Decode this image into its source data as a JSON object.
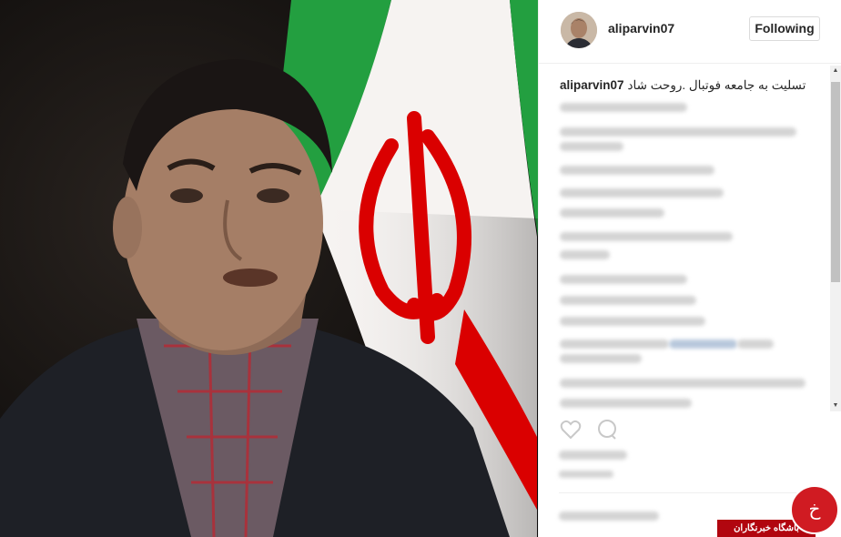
{
  "post": {
    "username": "aliparvin07",
    "follow_label": "Following",
    "caption_text": "تسلیت به جامعه فوتبال .روحت شاد"
  },
  "watermark": {
    "text": "باشگاه خبرنگاران",
    "glyph": "خ"
  },
  "colors": {
    "flag_green": "#239f40",
    "flag_red": "#da0000",
    "link_blue": "#003569"
  }
}
